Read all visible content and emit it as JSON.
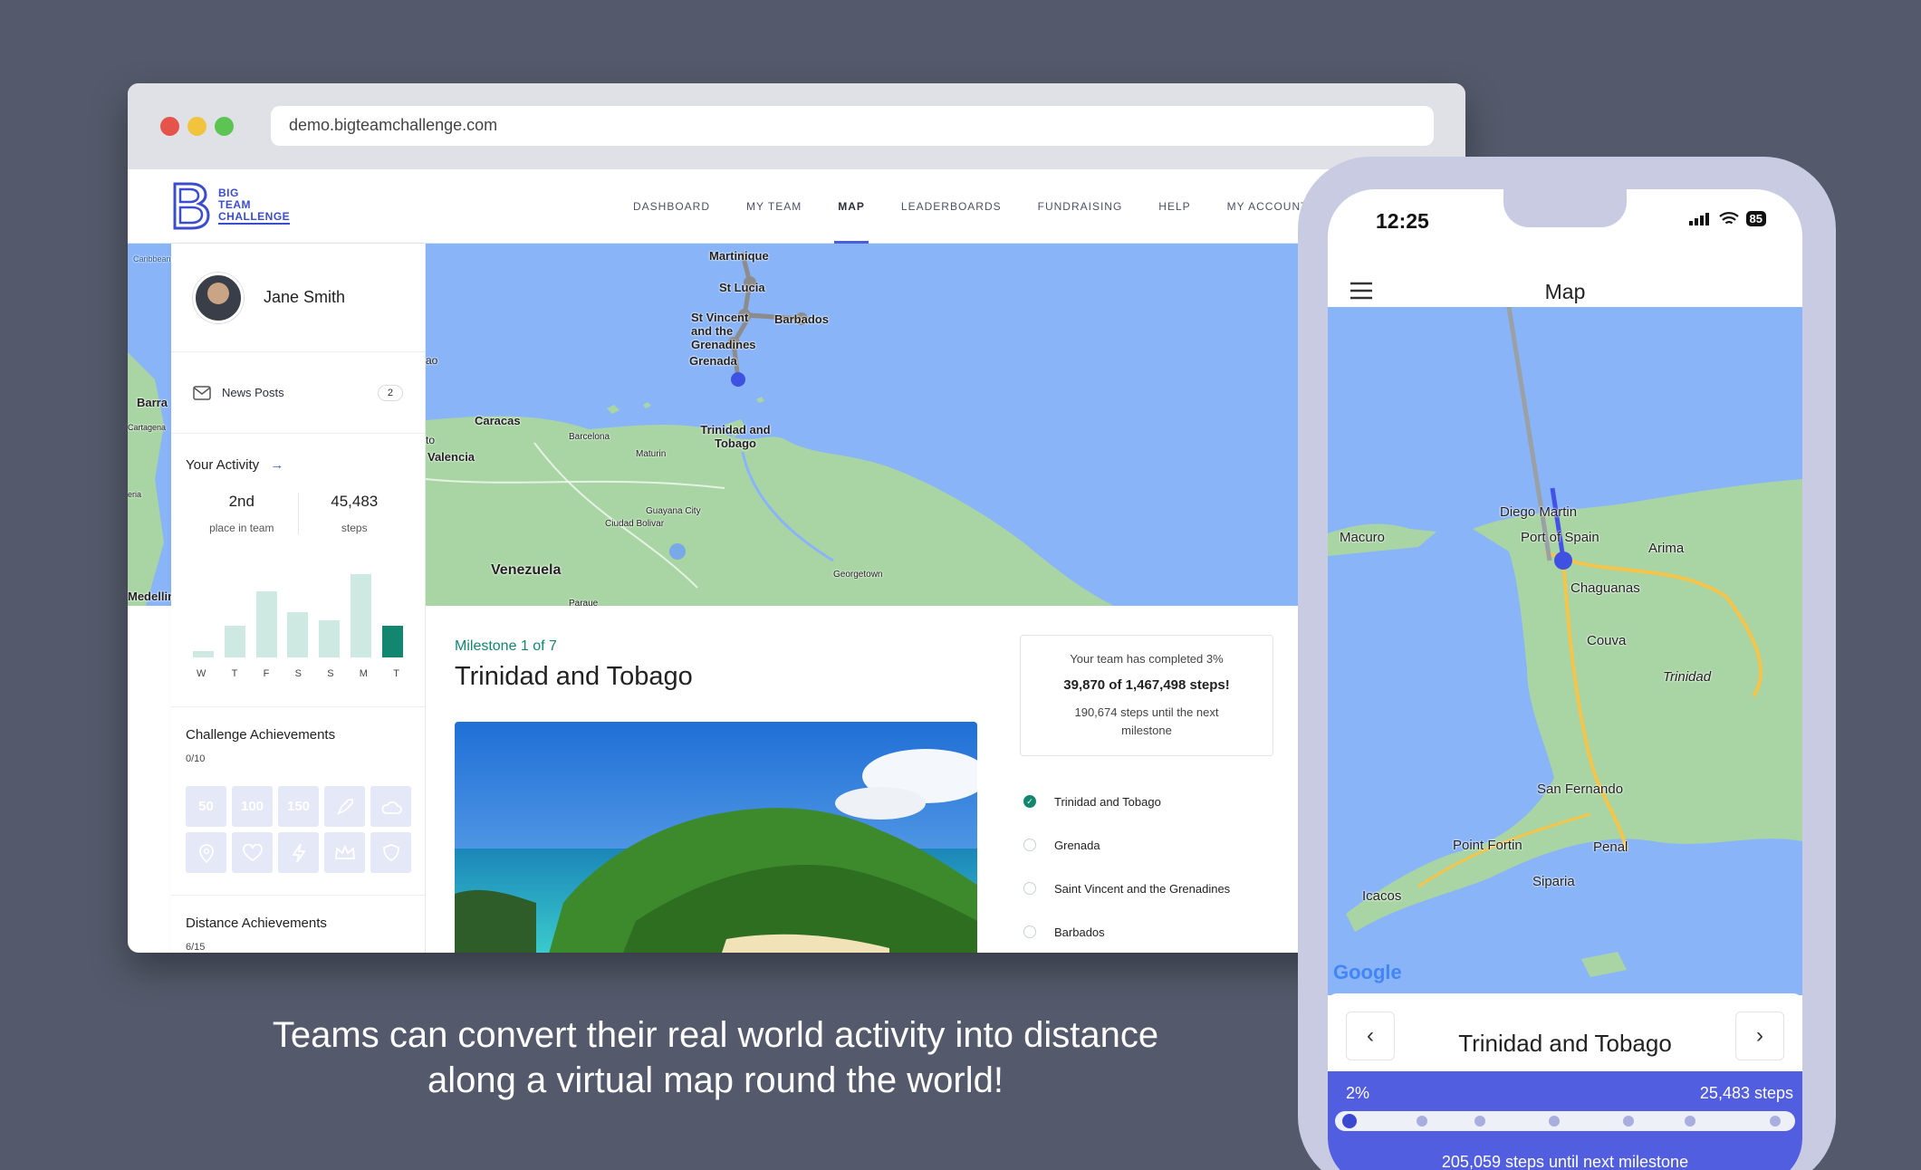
{
  "browser": {
    "url": "demo.bigteamchallenge.com",
    "dot_colors": [
      "#e5534b",
      "#f2c33d",
      "#5cc453"
    ]
  },
  "site": {
    "logo_lines": [
      "BIG",
      "TEAM",
      "CHALLENGE"
    ],
    "nav": [
      "DASHBOARD",
      "MY TEAM",
      "MAP",
      "LEADERBOARDS",
      "FUNDRAISING",
      "HELP",
      "MY ACCOUNT"
    ],
    "active_nav": "MAP"
  },
  "sidebar": {
    "user_name": "Jane Smith",
    "news_label": "News Posts",
    "news_count": "2",
    "activity_title": "Your Activity",
    "stats": [
      {
        "value": "2nd",
        "label": "place in team"
      },
      {
        "value": "45,483",
        "label": "steps"
      }
    ],
    "week_bars": {
      "days": [
        "W",
        "T",
        "F",
        "S",
        "S",
        "M",
        "T"
      ],
      "values": [
        0.05,
        0.25,
        0.52,
        0.36,
        0.29,
        0.66,
        0.25
      ]
    },
    "challenge_title": "Challenge Achievements",
    "challenge_count": "0/10",
    "achievement_labels": [
      "50",
      "100",
      "150"
    ],
    "achievement_icons": [
      "rocket-icon",
      "cloud-icon",
      "pin-icon",
      "heart-icon",
      "bolt-icon",
      "crown-icon",
      "shield-icon"
    ],
    "distance_title": "Distance Achievements",
    "distance_count": "6/15"
  },
  "map": {
    "labels": [
      "Martinique",
      "St Lucia",
      "St Vincent and the Grenadines",
      "Barbados",
      "Grenada",
      "Trinidad and Tobago",
      "Caracas",
      "Valencia",
      "Barcelona",
      "Maturin",
      "Guayana City",
      "Ciudad Bolivar",
      "Venezuela",
      "Georgetown",
      "Barra",
      "Cartagena",
      "Medellin",
      "Caribbean",
      "ao",
      "to",
      "eria",
      "Paraue"
    ],
    "route_colors": {
      "done": "#8c8c8c",
      "current": "#3f51e0"
    }
  },
  "milestone": {
    "step_label": "Milestone 1 of 7",
    "title": "Trinidad and Tobago",
    "progress_line1": "Your team has completed 3%",
    "progress_line2": "39,870 of 1,467,498 steps!",
    "progress_line3": "190,674 steps until the next milestone",
    "list": [
      "Trinidad and Tobago",
      "Grenada",
      "Saint Vincent and the Grenadines",
      "Barbados"
    ],
    "completed_index": 0
  },
  "caption": {
    "line1": "Teams can convert their real world activity into distance",
    "line2": "along a virtual map round the world!"
  },
  "phone": {
    "time": "12:25",
    "battery": "85",
    "title": "Map",
    "map_labels": [
      "Diego Martin",
      "Port of Spain",
      "Arima",
      "Macuro",
      "Chaguanas",
      "Couva",
      "Trinidad",
      "San Fernando",
      "Point Fortin",
      "Penal",
      "Siparia",
      "Icacos"
    ],
    "google_label": "Google",
    "card_title": "Trinidad and Tobago",
    "percent": "2%",
    "steps": "25,483 steps",
    "progress_fraction": 0.02,
    "next": "205,059 steps until next milestone"
  }
}
